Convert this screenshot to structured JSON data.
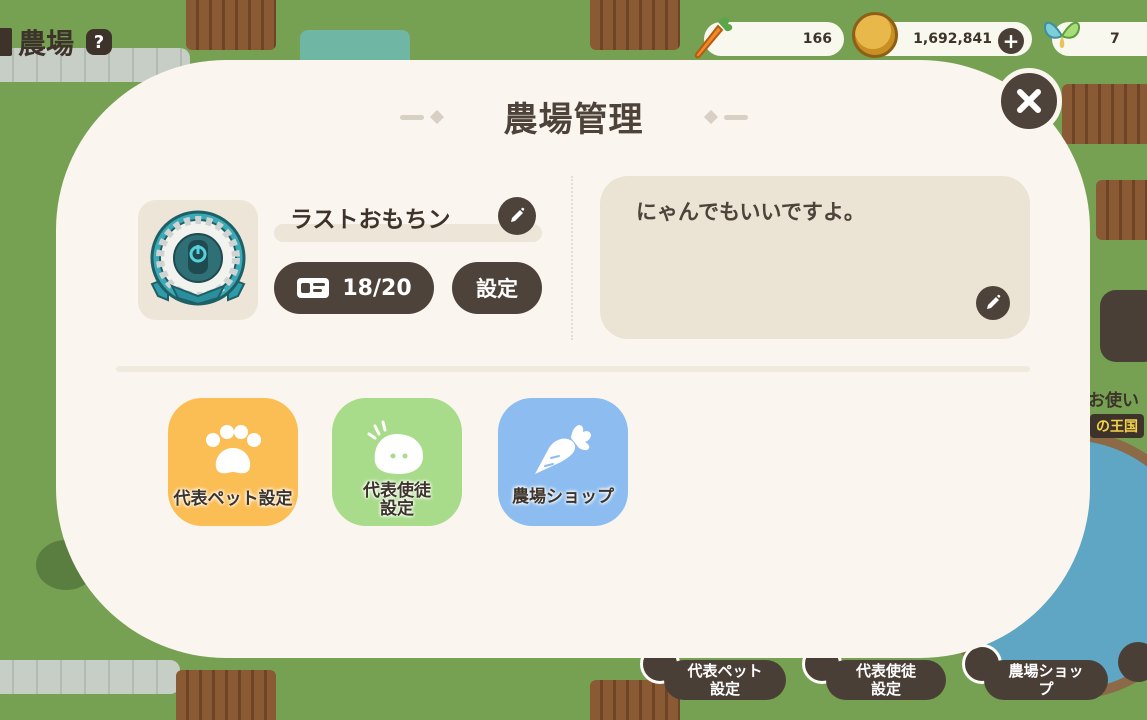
{
  "hud": {
    "farm_title": "農場",
    "help_label": "?",
    "carrot_count": "166",
    "coin_count": "1,692,841",
    "gem_count": "7",
    "coin_add_label": "+"
  },
  "modal": {
    "title": "農場管理",
    "close_label": "×",
    "player_name": "ラストおもちン",
    "member_count": "18/20",
    "settings_label": "設定",
    "message": "にゃんでもいいですよ。"
  },
  "menu_tiles": [
    {
      "label": "代表ペット設定"
    },
    {
      "label": "代表使徒\n設定"
    },
    {
      "label": "農場ショップ"
    }
  ],
  "bottom_bar": [
    {
      "label": "代表ペット\n設定"
    },
    {
      "label": "代表使徒\n設定"
    },
    {
      "label": "農場ショッ\nプ"
    }
  ],
  "side": {
    "label": "お使い",
    "badge": "の王国"
  },
  "colors": {
    "panel": "#faf6ef",
    "dark": "#4e433a",
    "pet_tile": "#fbbe55",
    "disciple_tile": "#a8dc8a",
    "shop_tile": "#8dbdf0",
    "message_box": "#ebe3d4"
  }
}
